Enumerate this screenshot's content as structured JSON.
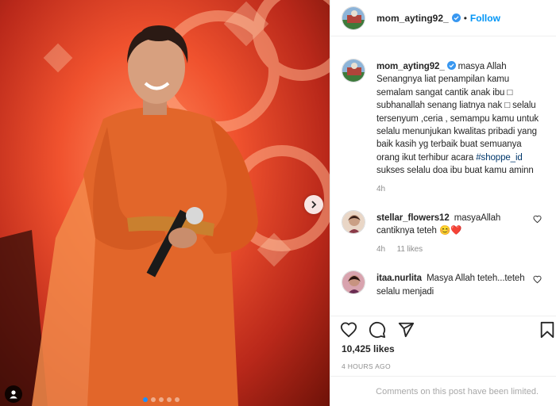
{
  "post": {
    "username": "mom_ayting92_",
    "separator": "•",
    "follow_label": "Follow",
    "carousel": {
      "current": 1,
      "total": 5
    }
  },
  "comments": [
    {
      "username": "mom_ayting92_",
      "verified": true,
      "text_before": "masya Allah Senangnya liat penampilan kamu semalam sangat cantik anak ibu □ subhanallah senang liatnya nak □ selalu tersenyum ,ceria , semampu kamu untuk selalu menunjukan kwalitas pribadi yang baik kasih yg terbaik buat semuanya orang ikut terhibur acara ",
      "hashtag": "#shoppe_id",
      "text_after": " sukses selalu doa ibu buat kamu aminn",
      "time": "4h"
    },
    {
      "username": "stellar_flowers12",
      "text": "masyaAllah cantiknya teteh 😊❤️",
      "time": "4h",
      "likes": "11 likes"
    },
    {
      "username": "itaa.nurlita",
      "text": "Masya Allah teteh...teteh selalu menjadi",
      "time": ""
    }
  ],
  "likes_text": "10,425 likes",
  "timestamp": "4 HOURS AGO",
  "comments_limited": "Comments on this post have been limited.",
  "colors": {
    "link": "#0095f6",
    "verified": "#3897f0",
    "muted": "#8e8e8e",
    "hashtag": "#00376b"
  },
  "icons": [
    "heart-icon",
    "comment-icon",
    "share-icon",
    "bookmark-icon",
    "chevron-right-icon",
    "user-tag-icon",
    "verified-badge-icon"
  ]
}
